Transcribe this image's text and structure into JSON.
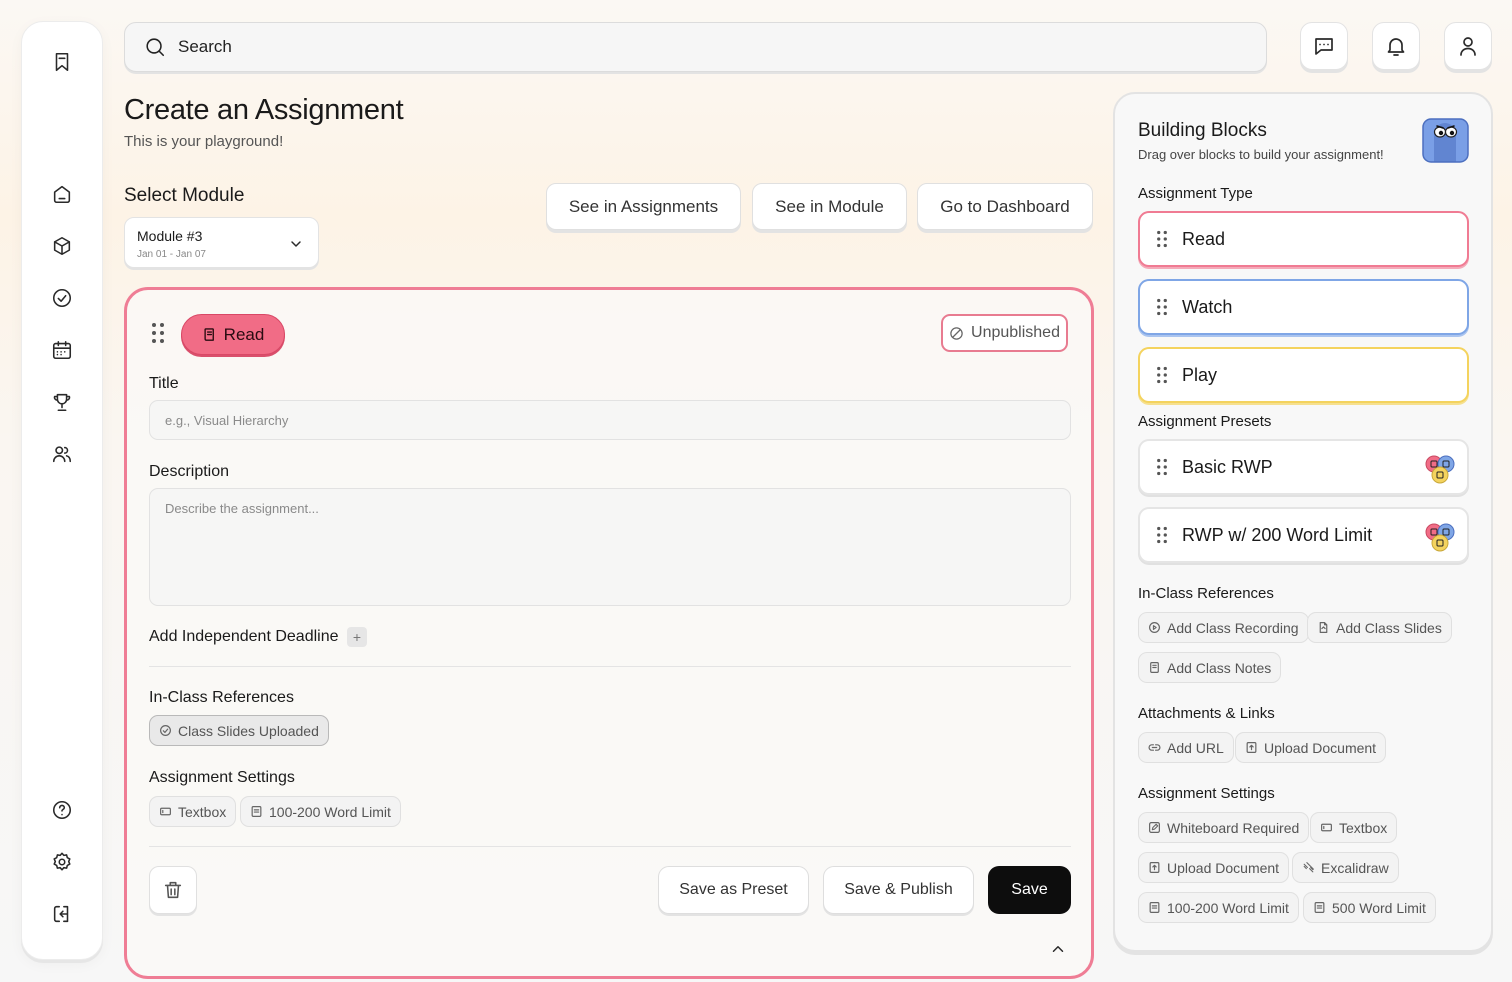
{
  "search": {
    "placeholder": "Search"
  },
  "sidebar": {
    "items": [
      {
        "icon": "bookmark-icon"
      },
      {
        "icon": "home-icon"
      },
      {
        "icon": "cube-icon"
      },
      {
        "icon": "check-circle-icon"
      },
      {
        "icon": "calendar-icon"
      },
      {
        "icon": "trophy-icon"
      },
      {
        "icon": "users-icon"
      },
      {
        "icon": "help-icon"
      },
      {
        "icon": "gear-icon"
      },
      {
        "icon": "logout-icon"
      }
    ]
  },
  "header": {
    "title": "Create an Assignment",
    "subtitle": "This is your playground!",
    "module_label": "Select Module",
    "module": {
      "name": "Module #3",
      "dates": "Jan 01 - Jan 07"
    },
    "nav_buttons": [
      "See in Assignments",
      "See in Module",
      "Go to Dashboard"
    ]
  },
  "editor": {
    "type_label": "Read",
    "status": "Unpublished",
    "title_label": "Title",
    "title_placeholder": "e.g., Visual Hierarchy",
    "description_label": "Description",
    "description_placeholder": "Describe the assignment...",
    "deadline_label": "Add Independent Deadline",
    "references_label": "In-Class References",
    "references": [
      "Class Slides Uploaded"
    ],
    "settings_label": "Assignment Settings",
    "settings": [
      "Textbox",
      "100-200 Word Limit"
    ],
    "actions": {
      "preset": "Save as Preset",
      "publish": "Save & Publish",
      "save": "Save"
    }
  },
  "panel": {
    "title": "Building Blocks",
    "subtitle": "Drag over blocks to build your assignment!",
    "type_label": "Assignment Type",
    "types": [
      "Read",
      "Watch",
      "Play"
    ],
    "presets_label": "Assignment Presets",
    "presets": [
      "Basic RWP",
      "RWP w/ 200 Word Limit"
    ],
    "references_label": "In-Class References",
    "references": [
      "Add Class Recording",
      "Add Class Slides",
      "Add Class Notes"
    ],
    "attachments_label": "Attachments & Links",
    "attachments": [
      "Add URL",
      "Upload Document"
    ],
    "settings_label": "Assignment Settings",
    "settings": [
      "Whiteboard Required",
      "Textbox",
      "Upload Document",
      "Excalidraw",
      "100-200 Word Limit",
      "500 Word Limit"
    ]
  },
  "colors": {
    "read": "#f16c86",
    "watch": "#7fa6e6",
    "play": "#f4d35e",
    "primary": "#0d0d0d"
  }
}
